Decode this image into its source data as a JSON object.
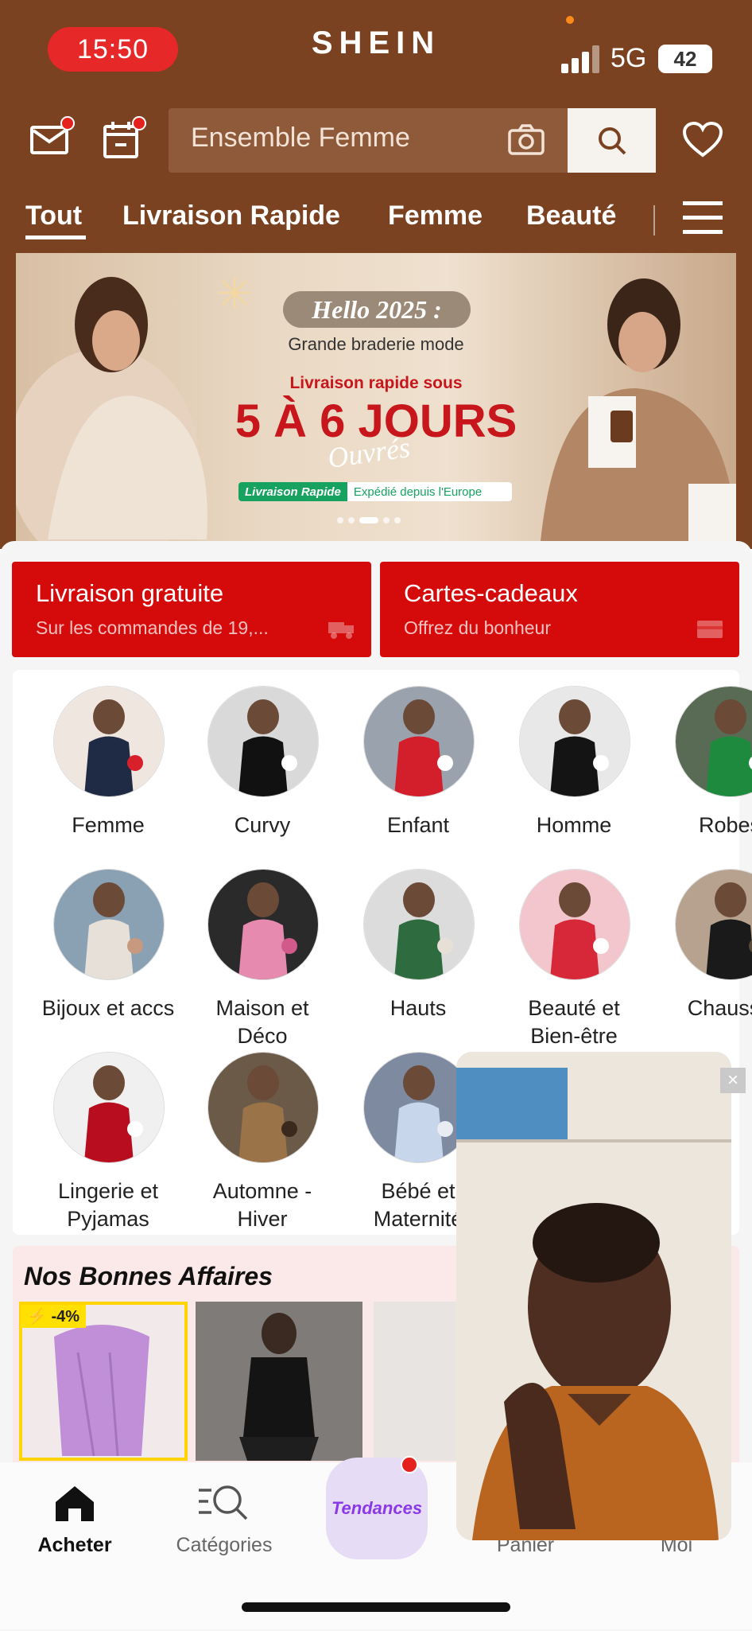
{
  "status_bar": {
    "time": "15:50",
    "network": "5G",
    "battery": "42"
  },
  "brand": "SHEIN",
  "search": {
    "placeholder": "Ensemble Femme"
  },
  "tabs": [
    {
      "label": "Tout",
      "active": true
    },
    {
      "label": "Livraison Rapide"
    },
    {
      "label": "Femme"
    },
    {
      "label": "Beauté"
    }
  ],
  "banner": {
    "title": "Hello 2025 :",
    "subtitle": "Grande braderie mode",
    "delivery_line": "Livraison rapide sous",
    "headline": "5 À 6 JOURS",
    "script": "Ouvrés",
    "strip_tag": "Livraison Rapide",
    "strip_text": "Expédié depuis l'Europe",
    "slide_count": 5,
    "active_slide": 3
  },
  "promos": [
    {
      "title": "Livraison gratuite",
      "subtitle": "Sur les commandes de  19,..."
    },
    {
      "title": "Cartes-cadeaux",
      "subtitle": "Offrez du bonheur"
    }
  ],
  "categories": [
    {
      "line1": "Femme",
      "line2": ""
    },
    {
      "line1": "Curvy",
      "line2": ""
    },
    {
      "line1": "Enfant",
      "line2": ""
    },
    {
      "line1": "Homme",
      "line2": ""
    },
    {
      "line1": "Robes",
      "line2": ""
    },
    {
      "line1": "Bijoux et accs",
      "line2": ""
    },
    {
      "line1": "Maison et",
      "line2": "Déco"
    },
    {
      "line1": "Hauts",
      "line2": ""
    },
    {
      "line1": "Beauté et",
      "line2": "Bien-être"
    },
    {
      "line1": "Chaussu",
      "line2": ""
    },
    {
      "line1": "Lingerie et",
      "line2": "Pyjamas"
    },
    {
      "line1": "Automne -",
      "line2": "Hiver"
    },
    {
      "line1": "Bébé et",
      "line2": "Maternité"
    }
  ],
  "deals": {
    "title": "Nos Bonnes Affaires",
    "badge": "-4%"
  },
  "bottom_nav": [
    {
      "label": "Acheter",
      "active": true
    },
    {
      "label": "Catégories"
    },
    {
      "label": "Tendances"
    },
    {
      "label": "Panier"
    },
    {
      "label": "Moi"
    }
  ],
  "colors": {
    "header_bg": "#7a4220",
    "promo_red": "#d50b0b",
    "badge_red": "#e5211d",
    "trend_purple": "#8a39e6"
  }
}
